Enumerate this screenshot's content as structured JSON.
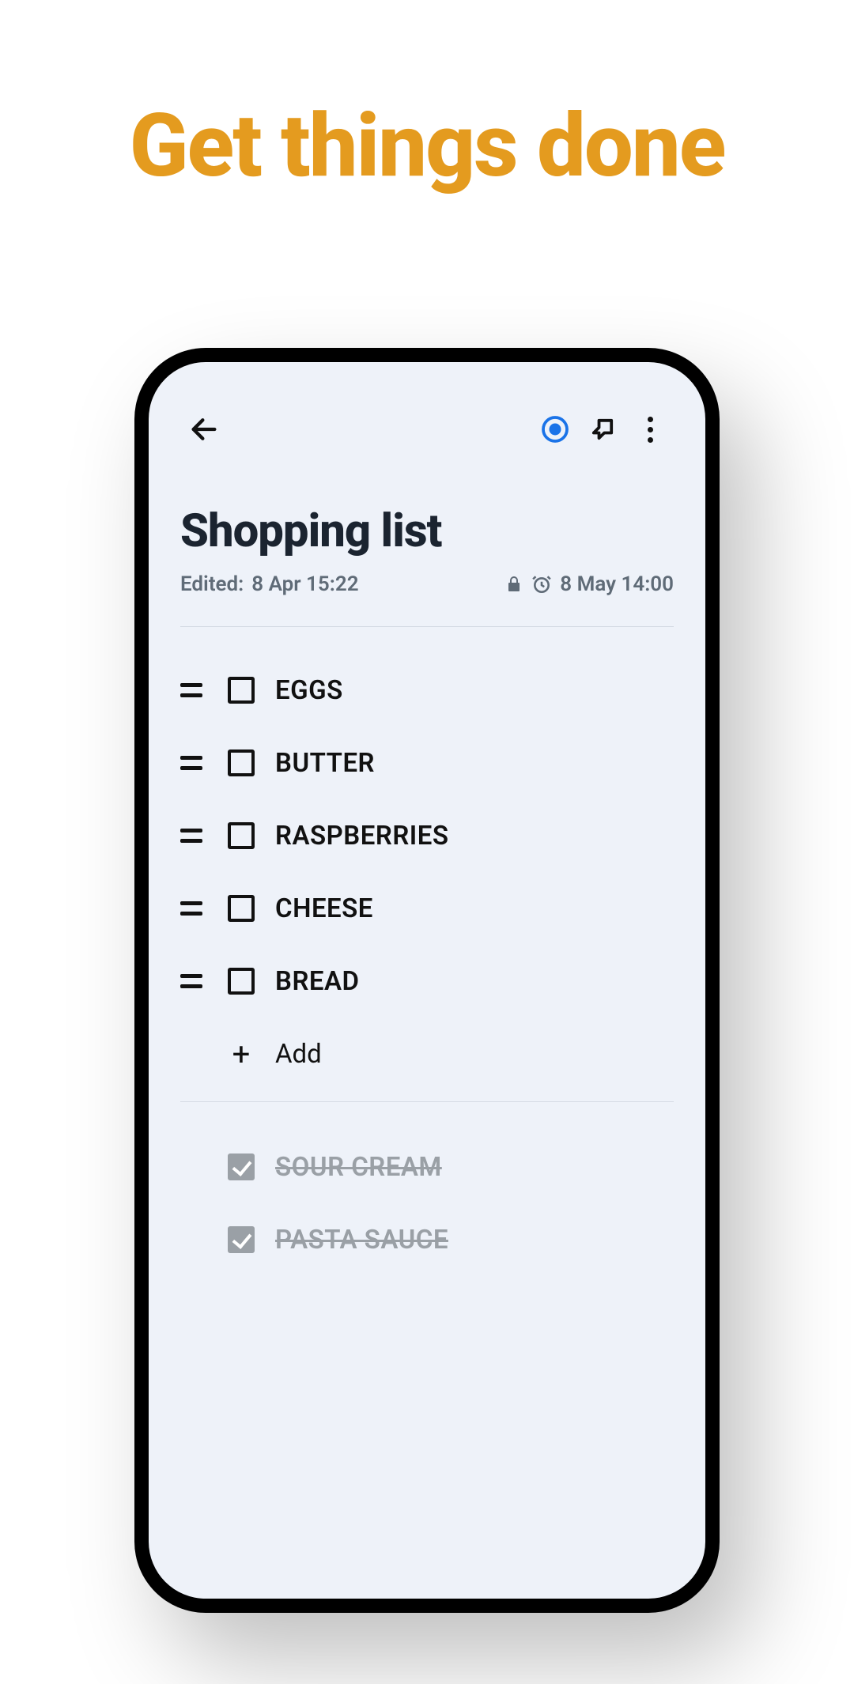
{
  "hero": "Get things done",
  "note": {
    "title": "Shopping list",
    "edited_prefix": "Edited:",
    "edited_value": "8 Apr 15:22",
    "reminder": "8 May  14:00",
    "add_label": "Add",
    "items": [
      {
        "label": "EGGS",
        "done": false
      },
      {
        "label": "BUTTER",
        "done": false
      },
      {
        "label": "RASPBERRIES",
        "done": false
      },
      {
        "label": "CHEESE",
        "done": false
      },
      {
        "label": "BREAD",
        "done": false
      }
    ],
    "completed": [
      {
        "label": "SOUR CREAM",
        "done": true
      },
      {
        "label": "PASTA SAUCE",
        "done": true
      }
    ]
  }
}
